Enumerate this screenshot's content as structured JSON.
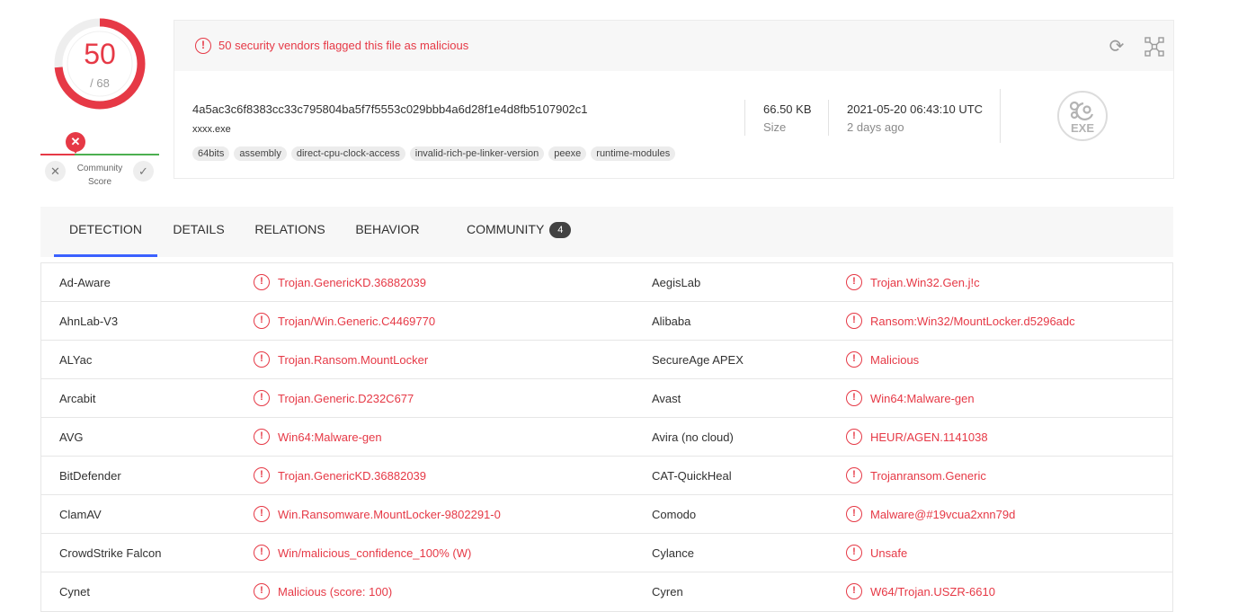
{
  "score": {
    "detected": "50",
    "total": "/ 68",
    "ratio": 0.735
  },
  "community": {
    "label": "Community Score",
    "pin_icon": "x-icon",
    "down_icon": "x-icon",
    "up_icon": "check-icon",
    "colors": {
      "negative": "#e63946",
      "positive": "#4caf50"
    }
  },
  "file": {
    "alert": "50 security vendors flagged this file as malicious",
    "hash": "4a5ac3c6f8383cc33c795804ba5f7f5553c029bbb4a6d28f1e4d8fb5107902c1",
    "name": "xxxx.exe",
    "tags": [
      "64bits",
      "assembly",
      "direct-cpu-clock-access",
      "invalid-rich-pe-linker-version",
      "peexe",
      "runtime-modules"
    ],
    "size_value": "66.50 KB",
    "size_label": "Size",
    "date_value": "2021-05-20 06:43:10 UTC",
    "date_ago": "2 days ago",
    "type_label": "EXE",
    "icons": {
      "reload": "reload-icon",
      "graph": "graph-icon",
      "type": "exe-file-icon"
    }
  },
  "tabs": [
    {
      "label": "DETECTION",
      "active": true
    },
    {
      "label": "DETAILS"
    },
    {
      "label": "RELATIONS"
    },
    {
      "label": "BEHAVIOR"
    },
    {
      "label": "COMMUNITY",
      "badge": "4"
    }
  ],
  "detections": [
    {
      "v1": "Ad-Aware",
      "r1": "Trojan.GenericKD.36882039",
      "v2": "AegisLab",
      "r2": "Trojan.Win32.Gen.j!c"
    },
    {
      "v1": "AhnLab-V3",
      "r1": "Trojan/Win.Generic.C4469770",
      "v2": "Alibaba",
      "r2": "Ransom:Win32/MountLocker.d5296adc"
    },
    {
      "v1": "ALYac",
      "r1": "Trojan.Ransom.MountLocker",
      "v2": "SecureAge APEX",
      "r2": "Malicious"
    },
    {
      "v1": "Arcabit",
      "r1": "Trojan.Generic.D232C677",
      "v2": "Avast",
      "r2": "Win64:Malware-gen"
    },
    {
      "v1": "AVG",
      "r1": "Win64:Malware-gen",
      "v2": "Avira (no cloud)",
      "r2": "HEUR/AGEN.1141038"
    },
    {
      "v1": "BitDefender",
      "r1": "Trojan.GenericKD.36882039",
      "v2": "CAT-QuickHeal",
      "r2": "Trojanransom.Generic"
    },
    {
      "v1": "ClamAV",
      "r1": "Win.Ransomware.MountLocker-9802291-0",
      "v2": "Comodo",
      "r2": "Malware@#19vcua2xnn79d"
    },
    {
      "v1": "CrowdStrike Falcon",
      "r1": "Win/malicious_confidence_100% (W)",
      "v2": "Cylance",
      "r2": "Unsafe"
    },
    {
      "v1": "Cynet",
      "r1": "Malicious (score: 100)",
      "v2": "Cyren",
      "r2": "W64/Trojan.USZR-6610"
    }
  ],
  "colors": {
    "malicious": "#e63946",
    "tab_active": "#3b61ff",
    "ring_track": "#eeeeee"
  }
}
